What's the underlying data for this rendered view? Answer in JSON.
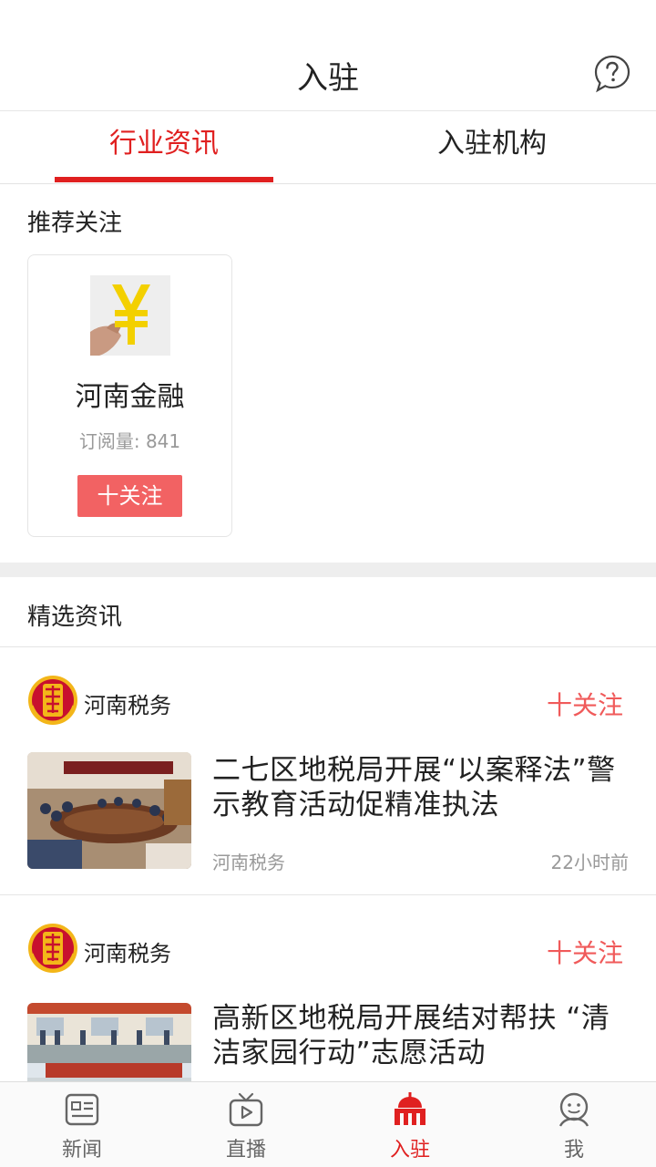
{
  "nav": {
    "title": "入驻",
    "help_icon": "question-circle-icon"
  },
  "tabs": [
    {
      "label": "行业资讯",
      "active": true
    },
    {
      "label": "入驻机构",
      "active": false
    }
  ],
  "recommended": {
    "title": "推荐关注",
    "card": {
      "name": "河南金融",
      "subscribers": "订阅量: 841",
      "follow_label": "十关注",
      "avatar_icon": "yen-sign-icon"
    }
  },
  "featured": {
    "title": "精选资讯",
    "items": [
      {
        "source": "河南税务",
        "follow_label": "十关注",
        "headline": "二七区地税局开展“以案释法”警示教育活动促精准执法",
        "meta_source": "河南税务",
        "time": "22小时前"
      },
      {
        "source": "河南税务",
        "follow_label": "十关注",
        "headline": "高新区地税局开展结对帮扶 “清洁家园行动”志愿活动",
        "meta_source": "",
        "time": ""
      }
    ]
  },
  "bottom_nav": [
    {
      "label": "新闻",
      "icon": "news-icon",
      "active": false
    },
    {
      "label": "直播",
      "icon": "tv-icon",
      "active": false
    },
    {
      "label": "入驻",
      "icon": "building-icon",
      "active": true
    },
    {
      "label": "我",
      "icon": "user-icon",
      "active": false
    }
  ],
  "colors": {
    "accent": "#e02020",
    "follow_button": "#f26263",
    "tax_logo_red": "#c8102e",
    "tax_logo_gold": "#f3b619"
  }
}
